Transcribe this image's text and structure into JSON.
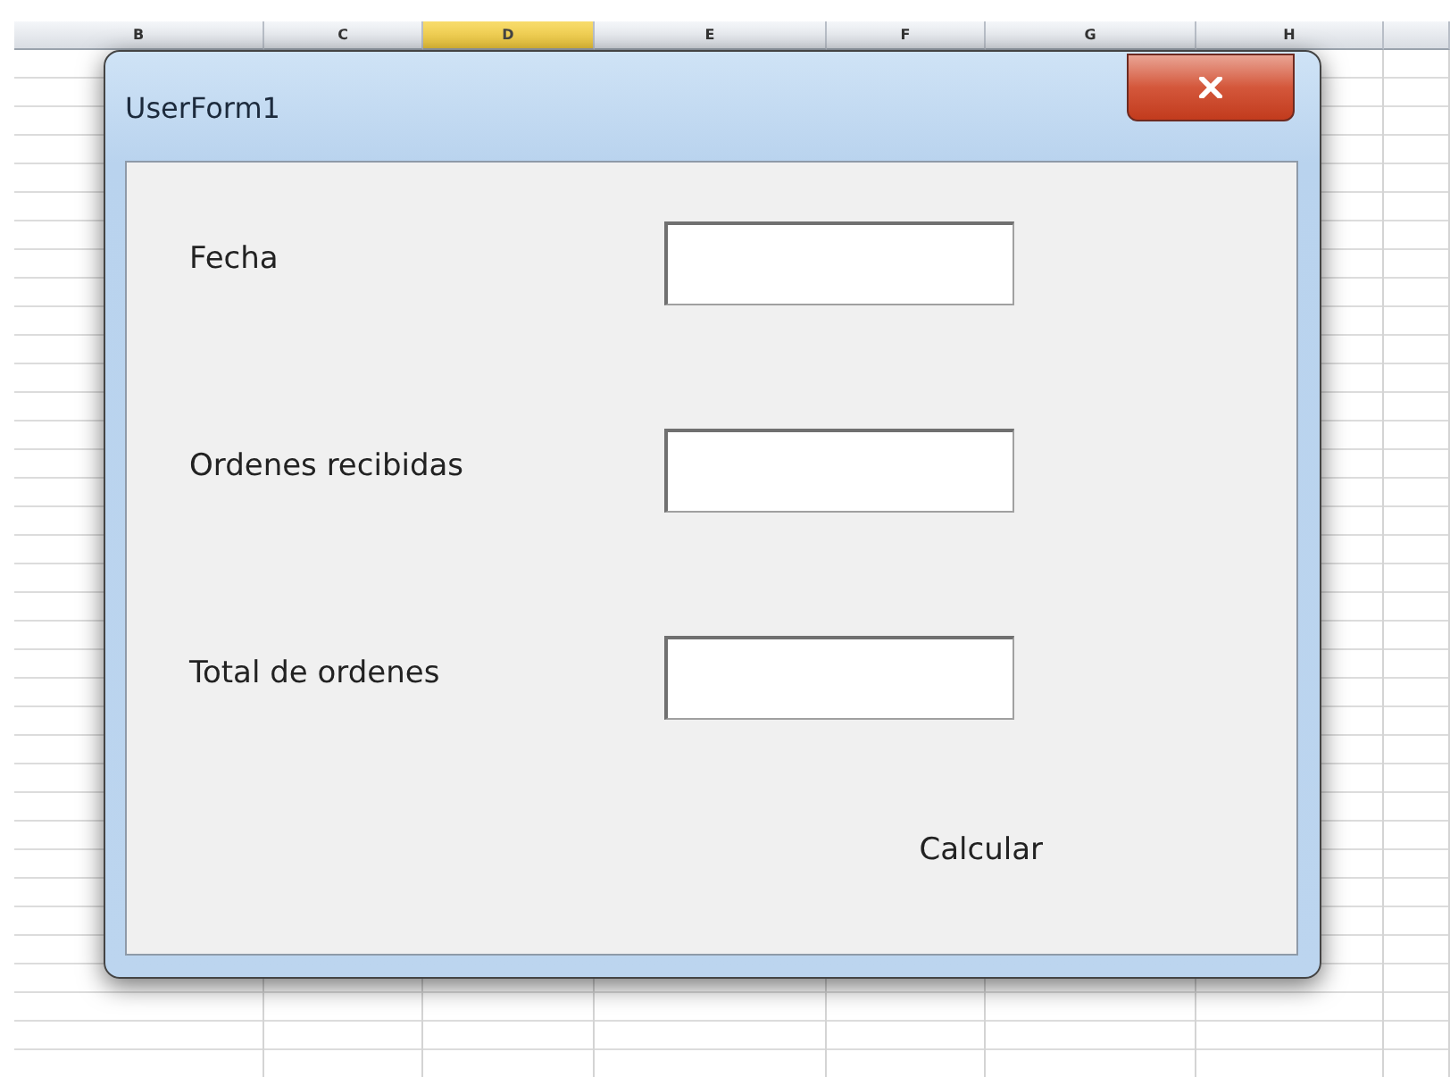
{
  "spreadsheet": {
    "columns": [
      {
        "label": "B",
        "selected": false
      },
      {
        "label": "C",
        "selected": false
      },
      {
        "label": "D",
        "selected": true
      },
      {
        "label": "E",
        "selected": false
      },
      {
        "label": "F",
        "selected": false
      },
      {
        "label": "G",
        "selected": false
      },
      {
        "label": "H",
        "selected": false
      }
    ]
  },
  "dialog": {
    "title": "UserForm1",
    "fields": [
      {
        "label": "Fecha"
      },
      {
        "label": "Ordenes recibidas"
      },
      {
        "label": "Total de ordenes"
      }
    ],
    "button": "Calcular"
  }
}
